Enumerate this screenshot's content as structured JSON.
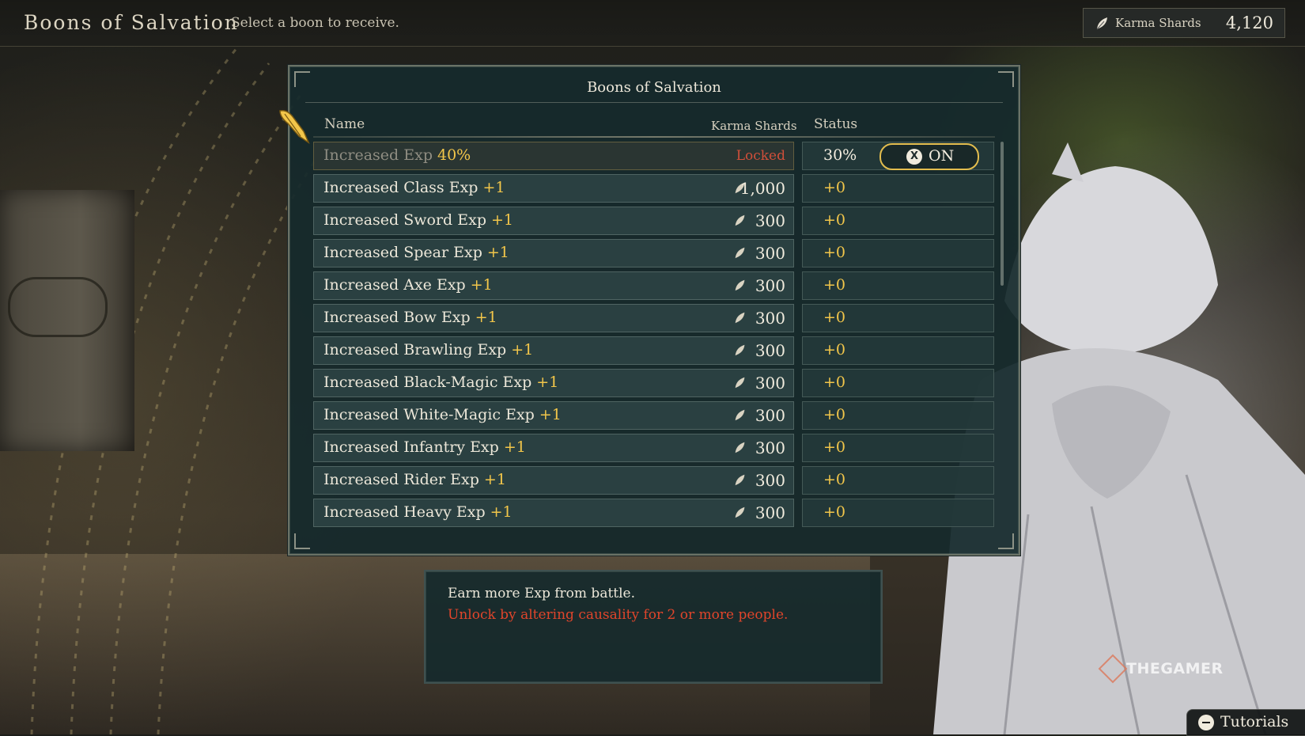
{
  "header": {
    "title": "Boons of Salvation",
    "subtitle": "Select a boon to receive.",
    "currency_label": "Karma Shards",
    "currency_value": "4,120",
    "currency_icon": "feather-icon"
  },
  "panel": {
    "title": "Boons of Salvation",
    "columns": {
      "name": "Name",
      "cost": "Karma Shards",
      "status": "Status"
    }
  },
  "boons": [
    {
      "name": "Increased Exp",
      "bonus": "40%",
      "cost": "Locked",
      "status": "30%",
      "toggle_key": "X",
      "toggle_label": "ON"
    },
    {
      "name": "Increased Class Exp",
      "bonus": "+1",
      "cost": "1,000",
      "status": "+0"
    },
    {
      "name": "Increased Sword Exp",
      "bonus": "+1",
      "cost": "300",
      "status": "+0"
    },
    {
      "name": "Increased Spear Exp",
      "bonus": "+1",
      "cost": "300",
      "status": "+0"
    },
    {
      "name": "Increased Axe Exp",
      "bonus": "+1",
      "cost": "300",
      "status": "+0"
    },
    {
      "name": "Increased Bow Exp",
      "bonus": "+1",
      "cost": "300",
      "status": "+0"
    },
    {
      "name": "Increased Brawling Exp",
      "bonus": "+1",
      "cost": "300",
      "status": "+0"
    },
    {
      "name": "Increased Black-Magic Exp",
      "bonus": "+1",
      "cost": "300",
      "status": "+0"
    },
    {
      "name": "Increased White-Magic Exp",
      "bonus": "+1",
      "cost": "300",
      "status": "+0"
    },
    {
      "name": "Increased Infantry Exp",
      "bonus": "+1",
      "cost": "300",
      "status": "+0"
    },
    {
      "name": "Increased Rider Exp",
      "bonus": "+1",
      "cost": "300",
      "status": "+0"
    },
    {
      "name": "Increased Heavy Exp",
      "bonus": "+1",
      "cost": "300",
      "status": "+0"
    }
  ],
  "description": {
    "line1": "Earn more Exp from battle.",
    "line2": "Unlock by altering causality for 2 or more people."
  },
  "watermark": "THEGAMER",
  "footer": {
    "tutorials_label": "Tutorials"
  },
  "colors": {
    "accent_gold": "#f2c64a",
    "locked_red": "#d04f3a",
    "panel_bg": "#162a2c"
  }
}
